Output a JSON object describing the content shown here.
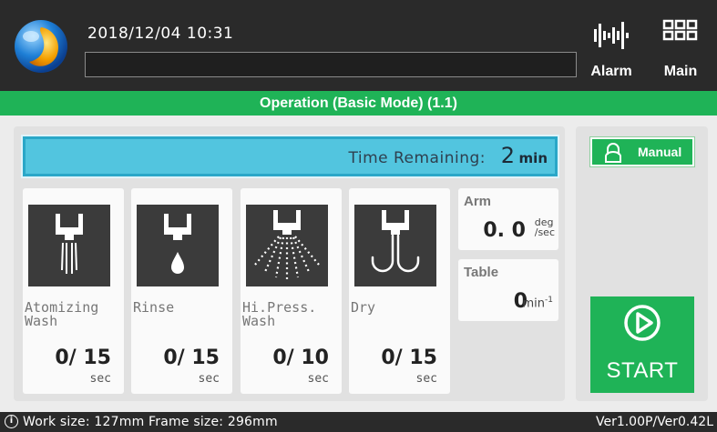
{
  "header": {
    "datetime": "2018/12/04  10:31",
    "message": "",
    "alarm_label": "Alarm",
    "main_label": "Main"
  },
  "title": "Operation (Basic Mode) (1.1)",
  "time_remaining": {
    "label": "Time Remaining:",
    "value": "2",
    "unit": "min"
  },
  "steps": [
    {
      "name": "Atomizing\nWash",
      "count": "0/ 15",
      "unit": "sec",
      "icon": "atomizing-wash-icon"
    },
    {
      "name": "Rinse",
      "count": "0/ 15",
      "unit": "sec",
      "icon": "rinse-icon"
    },
    {
      "name": "Hi.Press.\nWash",
      "count": "0/ 10",
      "unit": "sec",
      "icon": "high-pressure-wash-icon"
    },
    {
      "name": "Dry",
      "count": "0/ 15",
      "unit": "sec",
      "icon": "dry-icon"
    }
  ],
  "arm": {
    "label": "Arm",
    "value": "0. 0",
    "unit_top": "deg",
    "unit_bottom": "/sec"
  },
  "table": {
    "label": "Table",
    "value": "0",
    "unit": "min",
    "unit_sup": "-1"
  },
  "manual_label": "Manual",
  "start_label": "START",
  "footer": {
    "info": "Work size: 127mm   Frame size: 296mm",
    "version": "Ver1.00P/Ver0.42L"
  },
  "colors": {
    "header_bg": "#2a2a2a",
    "accent_green": "#1fb357",
    "time_bar": "#52c5df",
    "icon_bg": "#3b3b3b"
  }
}
